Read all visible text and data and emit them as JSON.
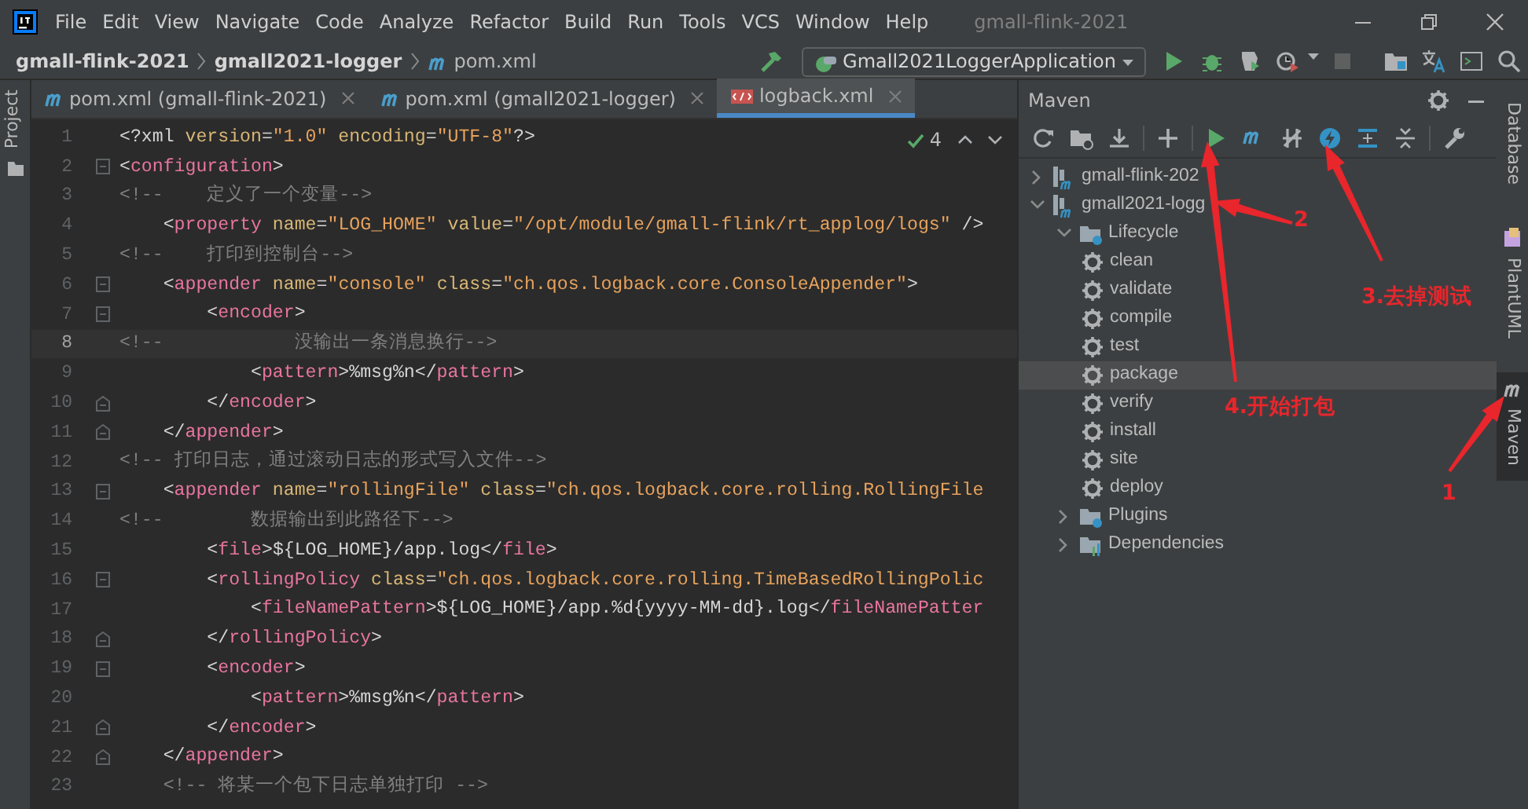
{
  "menu": [
    "File",
    "Edit",
    "View",
    "Navigate",
    "Code",
    "Analyze",
    "Refactor",
    "Build",
    "Run",
    "Tools",
    "VCS",
    "Window",
    "Help"
  ],
  "window": {
    "title": "gmall-flink-2021"
  },
  "breadcrumb": [
    "gmall-flink-2021",
    "gmall2021-logger",
    "pom.xml"
  ],
  "run_config": "Gmall2021LoggerApplication",
  "left_strip": [
    {
      "label": "Project",
      "selected": false
    }
  ],
  "tabs": [
    {
      "label": "pom.xml (gmall-flink-2021)",
      "kind": "maven",
      "selected": false
    },
    {
      "label": "pom.xml (gmall2021-logger)",
      "kind": "maven",
      "selected": false
    },
    {
      "label": "logback.xml",
      "kind": "xml",
      "selected": true
    }
  ],
  "inspection": {
    "count": "4"
  },
  "lines": [
    {
      "number": "1",
      "current": false,
      "tokens": [
        {
          "kind": "punct",
          "text": "<?xml "
        },
        {
          "kind": "attr",
          "text": "version"
        },
        {
          "kind": "punct",
          "text": "="
        },
        {
          "kind": "str",
          "text": "\"1.0\" "
        },
        {
          "kind": "attr",
          "text": "encoding"
        },
        {
          "kind": "punct",
          "text": "="
        },
        {
          "kind": "str",
          "text": "\"UTF-8\""
        },
        {
          "kind": "punct",
          "text": "?>"
        }
      ]
    },
    {
      "number": "2",
      "current": false,
      "fold": {
        "kind": "start"
      },
      "tokens": [
        {
          "kind": "punct",
          "text": "<"
        },
        {
          "kind": "tag",
          "text": "configuration"
        },
        {
          "kind": "punct",
          "text": ">"
        }
      ]
    },
    {
      "number": "3",
      "current": false,
      "tokens": [
        {
          "kind": "cmt",
          "text": "<!--    定义了一个变量-->"
        }
      ]
    },
    {
      "number": "4",
      "current": false,
      "tokens": [
        {
          "kind": "punct",
          "text": "    <"
        },
        {
          "kind": "tag",
          "text": "property "
        },
        {
          "kind": "attr",
          "text": "name"
        },
        {
          "kind": "punct",
          "text": "="
        },
        {
          "kind": "str",
          "text": "\"LOG_HOME\" "
        },
        {
          "kind": "attr",
          "text": "value"
        },
        {
          "kind": "punct",
          "text": "="
        },
        {
          "kind": "str",
          "text": "\"/opt/module/gmall-flink/rt_applog/logs\""
        },
        {
          "kind": "punct",
          "text": " />"
        }
      ]
    },
    {
      "number": "5",
      "current": false,
      "tokens": [
        {
          "kind": "cmt",
          "text": "<!--    打印到控制台-->"
        }
      ]
    },
    {
      "number": "6",
      "current": false,
      "fold": {
        "kind": "start"
      },
      "tokens": [
        {
          "kind": "punct",
          "text": "    <"
        },
        {
          "kind": "tag",
          "text": "appender "
        },
        {
          "kind": "attr",
          "text": "name"
        },
        {
          "kind": "punct",
          "text": "="
        },
        {
          "kind": "str",
          "text": "\"console\" "
        },
        {
          "kind": "attr",
          "text": "class"
        },
        {
          "kind": "punct",
          "text": "="
        },
        {
          "kind": "str",
          "text": "\"ch.qos.logback.core.ConsoleAppender\""
        },
        {
          "kind": "punct",
          "text": ">"
        }
      ]
    },
    {
      "number": "7",
      "current": false,
      "fold": {
        "kind": "start"
      },
      "tokens": [
        {
          "kind": "punct",
          "text": "        <"
        },
        {
          "kind": "tag",
          "text": "encoder"
        },
        {
          "kind": "punct",
          "text": ">"
        }
      ]
    },
    {
      "number": "8",
      "current": true,
      "tokens": [
        {
          "kind": "cmt",
          "text": "<!--            没输出一条消息换行-->"
        }
      ]
    },
    {
      "number": "9",
      "current": false,
      "tokens": [
        {
          "kind": "punct",
          "text": "            <"
        },
        {
          "kind": "tag",
          "text": "pattern"
        },
        {
          "kind": "punct",
          "text": ">"
        },
        {
          "kind": "txt",
          "text": "%msg%n"
        },
        {
          "kind": "punct",
          "text": "</"
        },
        {
          "kind": "tag",
          "text": "pattern"
        },
        {
          "kind": "punct",
          "text": ">"
        }
      ]
    },
    {
      "number": "10",
      "current": false,
      "fold": {
        "kind": "end"
      },
      "tokens": [
        {
          "kind": "punct",
          "text": "        </"
        },
        {
          "kind": "tag",
          "text": "encoder"
        },
        {
          "kind": "punct",
          "text": ">"
        }
      ]
    },
    {
      "number": "11",
      "current": false,
      "fold": {
        "kind": "end"
      },
      "tokens": [
        {
          "kind": "punct",
          "text": "    </"
        },
        {
          "kind": "tag",
          "text": "appender"
        },
        {
          "kind": "punct",
          "text": ">"
        }
      ]
    },
    {
      "number": "12",
      "current": false,
      "tokens": [
        {
          "kind": "cmt",
          "text": "<!-- 打印日志，通过滚动日志的形式写入文件-->"
        }
      ]
    },
    {
      "number": "13",
      "current": false,
      "fold": {
        "kind": "start"
      },
      "tokens": [
        {
          "kind": "punct",
          "text": "    <"
        },
        {
          "kind": "tag",
          "text": "appender "
        },
        {
          "kind": "attr",
          "text": "name"
        },
        {
          "kind": "punct",
          "text": "="
        },
        {
          "kind": "str",
          "text": "\"rollingFile\" "
        },
        {
          "kind": "attr",
          "text": "class"
        },
        {
          "kind": "punct",
          "text": "="
        },
        {
          "kind": "str",
          "text": "\"ch.qos.logback.core.rolling.RollingFile"
        }
      ]
    },
    {
      "number": "14",
      "current": false,
      "tokens": [
        {
          "kind": "cmt",
          "text": "<!--        数据输出到此路径下-->"
        }
      ]
    },
    {
      "number": "15",
      "current": false,
      "tokens": [
        {
          "kind": "punct",
          "text": "        <"
        },
        {
          "kind": "tag",
          "text": "file"
        },
        {
          "kind": "punct",
          "text": ">"
        },
        {
          "kind": "txt",
          "text": "${LOG_HOME}/app.log"
        },
        {
          "kind": "punct",
          "text": "</"
        },
        {
          "kind": "tag",
          "text": "file"
        },
        {
          "kind": "punct",
          "text": ">"
        }
      ]
    },
    {
      "number": "16",
      "current": false,
      "fold": {
        "kind": "start"
      },
      "tokens": [
        {
          "kind": "punct",
          "text": "        <"
        },
        {
          "kind": "tag",
          "text": "rollingPolicy "
        },
        {
          "kind": "attr",
          "text": "class"
        },
        {
          "kind": "punct",
          "text": "="
        },
        {
          "kind": "str",
          "text": "\"ch.qos.logback.core.rolling.TimeBasedRollingPolic"
        }
      ]
    },
    {
      "number": "17",
      "current": false,
      "tokens": [
        {
          "kind": "punct",
          "text": "            <"
        },
        {
          "kind": "tag",
          "text": "fileNamePattern"
        },
        {
          "kind": "punct",
          "text": ">"
        },
        {
          "kind": "txt",
          "text": "${LOG_HOME}/app.%d{yyyy-MM-dd}.log"
        },
        {
          "kind": "punct",
          "text": "</"
        },
        {
          "kind": "tag",
          "text": "fileNamePatter"
        }
      ]
    },
    {
      "number": "18",
      "current": false,
      "fold": {
        "kind": "end"
      },
      "tokens": [
        {
          "kind": "punct",
          "text": "        </"
        },
        {
          "kind": "tag",
          "text": "rollingPolicy"
        },
        {
          "kind": "punct",
          "text": ">"
        }
      ]
    },
    {
      "number": "19",
      "current": false,
      "fold": {
        "kind": "start"
      },
      "tokens": [
        {
          "kind": "punct",
          "text": "        <"
        },
        {
          "kind": "tag",
          "text": "encoder"
        },
        {
          "kind": "punct",
          "text": ">"
        }
      ]
    },
    {
      "number": "20",
      "current": false,
      "tokens": [
        {
          "kind": "punct",
          "text": "            <"
        },
        {
          "kind": "tag",
          "text": "pattern"
        },
        {
          "kind": "punct",
          "text": ">"
        },
        {
          "kind": "txt",
          "text": "%msg%n"
        },
        {
          "kind": "punct",
          "text": "</"
        },
        {
          "kind": "tag",
          "text": "pattern"
        },
        {
          "kind": "punct",
          "text": ">"
        }
      ]
    },
    {
      "number": "21",
      "current": false,
      "fold": {
        "kind": "end"
      },
      "tokens": [
        {
          "kind": "punct",
          "text": "        </"
        },
        {
          "kind": "tag",
          "text": "encoder"
        },
        {
          "kind": "punct",
          "text": ">"
        }
      ]
    },
    {
      "number": "22",
      "current": false,
      "fold": {
        "kind": "end"
      },
      "tokens": [
        {
          "kind": "punct",
          "text": "    </"
        },
        {
          "kind": "tag",
          "text": "appender"
        },
        {
          "kind": "punct",
          "text": ">"
        }
      ]
    },
    {
      "number": "23",
      "current": false,
      "tokens": [
        {
          "kind": "cmt",
          "text": "    <!-- 将某一个包下日志单独打印 -->"
        }
      ]
    }
  ],
  "maven": {
    "title": "Maven",
    "tree": [
      {
        "label": "gmall-flink-202",
        "kind": "project",
        "expanded": false,
        "selected": false
      },
      {
        "label": "gmall2021-logg",
        "kind": "project",
        "expanded": true,
        "selected": false,
        "children": [
          {
            "label": "Lifecycle",
            "kind": "lifecycle",
            "expanded": true,
            "selected": false,
            "children": [
              {
                "label": "clean",
                "kind": "goal",
                "selected": false
              },
              {
                "label": "validate",
                "kind": "goal",
                "selected": false
              },
              {
                "label": "compile",
                "kind": "goal",
                "selected": false
              },
              {
                "label": "test",
                "kind": "goal",
                "selected": false
              },
              {
                "label": "package",
                "kind": "goal",
                "selected": true
              },
              {
                "label": "verify",
                "kind": "goal",
                "selected": false
              },
              {
                "label": "install",
                "kind": "goal",
                "selected": false
              },
              {
                "label": "site",
                "kind": "goal",
                "selected": false
              },
              {
                "label": "deploy",
                "kind": "goal",
                "selected": false
              }
            ]
          },
          {
            "label": "Plugins",
            "kind": "plugins",
            "expanded": false,
            "selected": false
          },
          {
            "label": "Dependencies",
            "kind": "dependencies",
            "expanded": false,
            "selected": false
          }
        ]
      }
    ]
  },
  "right_strip": [
    {
      "label": "Database",
      "kind": "database",
      "selected": false
    },
    {
      "label": "PlantUML",
      "kind": "plantuml",
      "selected": false
    },
    {
      "label": "Maven",
      "kind": "maven",
      "selected": true
    }
  ],
  "annotations": [
    {
      "label": "1"
    },
    {
      "label": "2"
    },
    {
      "label": "3.去掉测试"
    },
    {
      "label": "4.开始打包"
    }
  ]
}
